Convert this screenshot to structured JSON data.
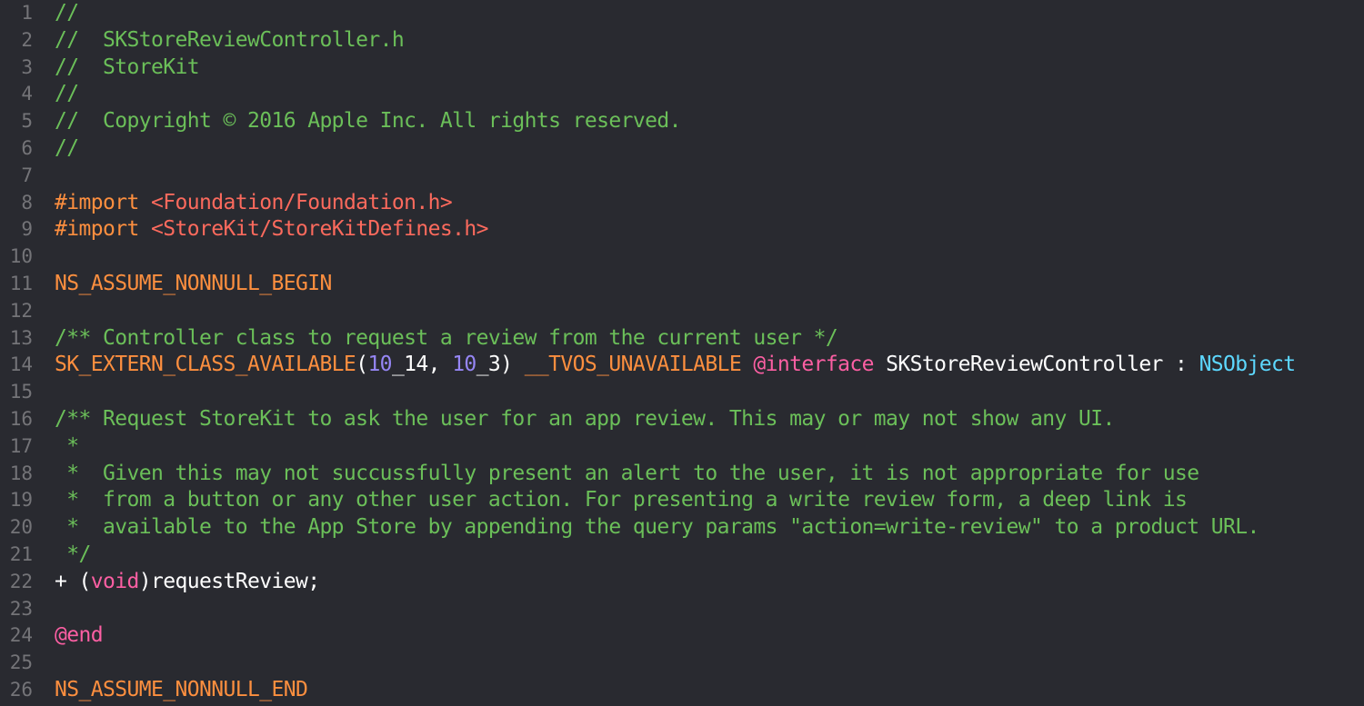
{
  "editor": {
    "theme_colors": {
      "background": "#292a30",
      "line_number": "#747478",
      "comment": "#6bbf59",
      "preprocessor": "#fd8f3f",
      "string": "#fc6a5d",
      "number": "#9686f5",
      "keyword": "#fc5fa3",
      "type": "#5dd8ff",
      "plain": "#ffffff"
    },
    "lines": [
      {
        "n": "1",
        "segments": [
          {
            "t": "//",
            "k": "comment"
          }
        ]
      },
      {
        "n": "2",
        "segments": [
          {
            "t": "//  SKStoreReviewController.h",
            "k": "comment"
          }
        ]
      },
      {
        "n": "3",
        "segments": [
          {
            "t": "//  StoreKit",
            "k": "comment"
          }
        ]
      },
      {
        "n": "4",
        "segments": [
          {
            "t": "//",
            "k": "comment"
          }
        ]
      },
      {
        "n": "5",
        "segments": [
          {
            "t": "//  Copyright © 2016 Apple Inc. All rights reserved.",
            "k": "comment"
          }
        ]
      },
      {
        "n": "6",
        "segments": [
          {
            "t": "//",
            "k": "comment"
          }
        ]
      },
      {
        "n": "7",
        "segments": []
      },
      {
        "n": "8",
        "segments": [
          {
            "t": "#import ",
            "k": "pre"
          },
          {
            "t": "<Foundation/Foundation.h>",
            "k": "str"
          }
        ]
      },
      {
        "n": "9",
        "segments": [
          {
            "t": "#import ",
            "k": "pre"
          },
          {
            "t": "<StoreKit/StoreKitDefines.h>",
            "k": "str"
          }
        ]
      },
      {
        "n": "10",
        "segments": []
      },
      {
        "n": "11",
        "segments": [
          {
            "t": "NS_ASSUME_NONNULL_BEGIN",
            "k": "macro"
          }
        ]
      },
      {
        "n": "12",
        "segments": []
      },
      {
        "n": "13",
        "segments": [
          {
            "t": "/** Controller class to request a review from the current user */",
            "k": "comment"
          }
        ]
      },
      {
        "n": "14",
        "segments": [
          {
            "t": "SK_EXTERN_CLASS_AVAILABLE",
            "k": "macro"
          },
          {
            "t": "(",
            "k": "plain"
          },
          {
            "t": "10",
            "k": "num"
          },
          {
            "t": "_14, ",
            "k": "plain"
          },
          {
            "t": "10",
            "k": "num"
          },
          {
            "t": "_3) ",
            "k": "plain"
          },
          {
            "t": "__TVOS_UNAVAILABLE",
            "k": "macro"
          },
          {
            "t": " ",
            "k": "plain"
          },
          {
            "t": "@interface",
            "k": "kw"
          },
          {
            "t": " SKStoreReviewController : ",
            "k": "plain"
          },
          {
            "t": "NSObject",
            "k": "type"
          }
        ]
      },
      {
        "n": "15",
        "segments": []
      },
      {
        "n": "16",
        "segments": [
          {
            "t": "/** Request StoreKit to ask the user for an app review. This may or may not show any UI.",
            "k": "comment"
          }
        ]
      },
      {
        "n": "17",
        "segments": [
          {
            "t": " *",
            "k": "comment"
          }
        ]
      },
      {
        "n": "18",
        "segments": [
          {
            "t": " *  Given this may not succussfully present an alert to the user, it is not appropriate for use",
            "k": "comment"
          }
        ]
      },
      {
        "n": "19",
        "segments": [
          {
            "t": " *  from a button or any other user action. For presenting a write review form, a deep link is",
            "k": "comment"
          }
        ]
      },
      {
        "n": "20",
        "segments": [
          {
            "t": " *  available to the App Store by appending the query params \"action=write-review\" to a product URL.",
            "k": "comment"
          }
        ]
      },
      {
        "n": "21",
        "segments": [
          {
            "t": " */",
            "k": "comment"
          }
        ]
      },
      {
        "n": "22",
        "segments": [
          {
            "t": "+ (",
            "k": "plain"
          },
          {
            "t": "void",
            "k": "kw"
          },
          {
            "t": ")requestReview;",
            "k": "plain"
          }
        ]
      },
      {
        "n": "23",
        "segments": []
      },
      {
        "n": "24",
        "segments": [
          {
            "t": "@end",
            "k": "kw"
          }
        ]
      },
      {
        "n": "25",
        "segments": []
      },
      {
        "n": "26",
        "segments": [
          {
            "t": "NS_ASSUME_NONNULL_END",
            "k": "macro"
          }
        ]
      }
    ]
  }
}
